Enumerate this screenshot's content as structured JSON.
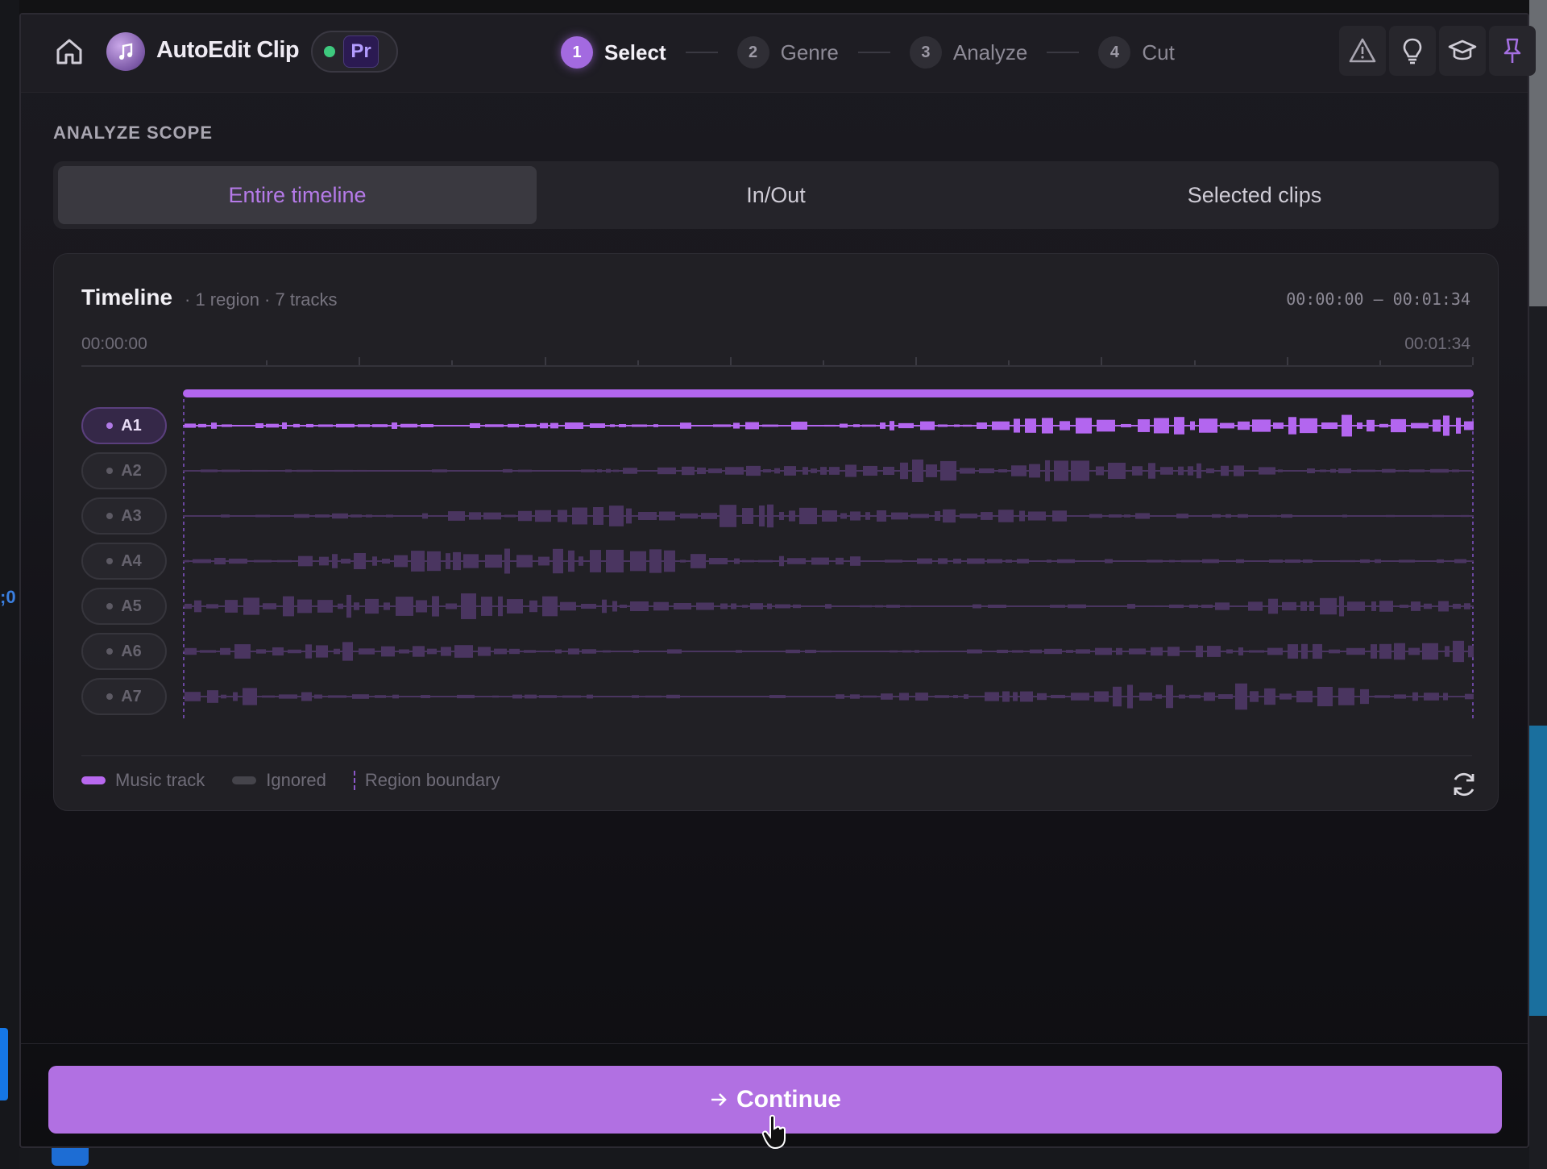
{
  "app": {
    "title": "AutoEdit Clip",
    "host_badge": "Pr",
    "host_status_color": "#3ec97e",
    "accent_color": "#b170e2"
  },
  "steps": [
    {
      "num": "1",
      "label": "Select",
      "active": true
    },
    {
      "num": "2",
      "label": "Genre",
      "active": false
    },
    {
      "num": "3",
      "label": "Analyze",
      "active": false
    },
    {
      "num": "4",
      "label": "Cut",
      "active": false
    }
  ],
  "toolbar": {
    "icons": [
      "warning-icon",
      "lightbulb-icon",
      "graduation-cap-icon",
      "pin-icon"
    ]
  },
  "scope": {
    "title": "ANALYZE SCOPE",
    "options": [
      {
        "label": "Entire timeline",
        "selected": true
      },
      {
        "label": "In/Out",
        "selected": false
      },
      {
        "label": "Selected clips",
        "selected": false
      }
    ]
  },
  "timeline": {
    "title": "Timeline",
    "subtitle": "· 1 region · 7 tracks",
    "range": "00:00:00 – 00:01:34",
    "start": "00:00:00",
    "end": "00:01:34",
    "tracks": [
      {
        "label": "A1",
        "music": true
      },
      {
        "label": "A2",
        "music": false
      },
      {
        "label": "A3",
        "music": false
      },
      {
        "label": "A4",
        "music": false
      },
      {
        "label": "A5",
        "music": false
      },
      {
        "label": "A6",
        "music": false
      },
      {
        "label": "A7",
        "music": false
      }
    ]
  },
  "legend": {
    "music": "Music track",
    "ignored": "Ignored",
    "boundary": "Region boundary"
  },
  "footer": {
    "continue_label": "Continue",
    "continue_icon": "arrow-right-icon"
  }
}
